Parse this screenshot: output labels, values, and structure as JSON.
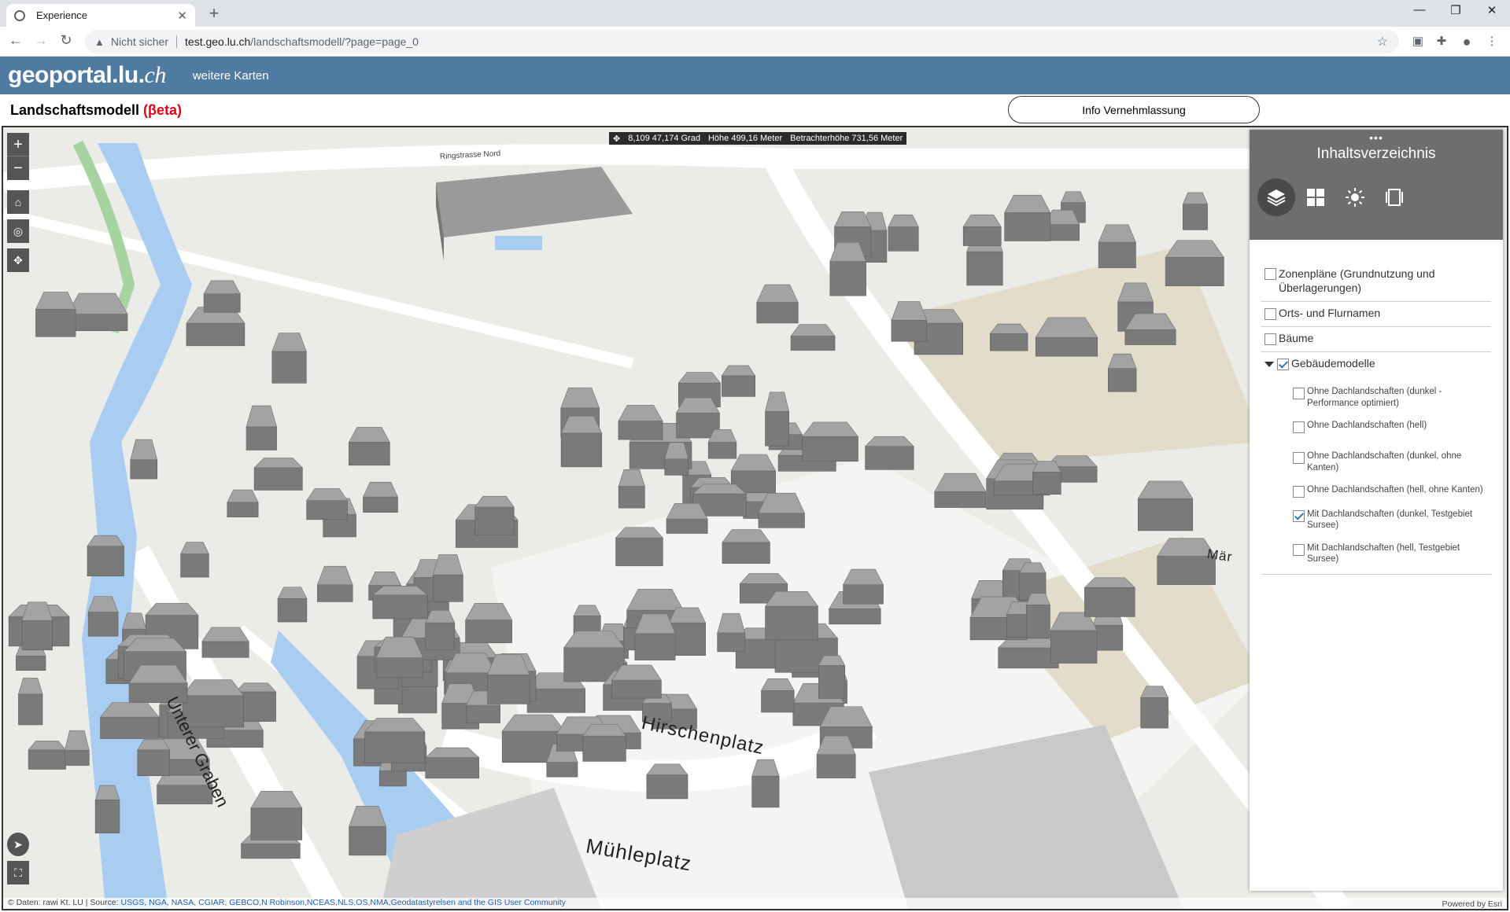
{
  "browser": {
    "tab_title": "Experience",
    "tab_close": "✕",
    "new_tab": "+",
    "security_label": "Nicht sicher",
    "url_host": "test.geo.lu.ch",
    "url_path": "/landschaftsmodell/?page=page_0"
  },
  "header": {
    "logo_text": "geoportal.lu.",
    "logo_suffix": "ch",
    "nav_link": "weitere Karten"
  },
  "page": {
    "title": "Landschaftsmodell",
    "beta": "(βeta)",
    "info_button": "Info Vernehmlassung"
  },
  "map": {
    "coord": "8,109 47,174 Grad",
    "height": "Höhe 499,16 Meter",
    "viewer_height": "Betrachterhöhe 731,56 Meter",
    "street_labels": [
      "Mühleplatz",
      "Hirschenplatz",
      "Unterer Graben",
      "Ringstrasse Nord",
      "Mär"
    ],
    "attribution_prefix": "© Daten: rawi Kt. LU | Source: ",
    "attribution_links": "USGS, NGA, NASA, CGIAR, GEBCO,N Robinson,NCEAS,NLS,OS,NMA,Geodatastyrelsen and the GIS User Community",
    "powered_by": "Powered by Esri"
  },
  "panel": {
    "title": "Inhaltsverzeichnis",
    "tabs": [
      "layers-icon",
      "basemap-gallery-icon",
      "daylight-icon",
      "slides-icon"
    ],
    "layers": [
      {
        "label": "Zonenpläne (Grundnutzung und Überlagerungen)",
        "checked": false
      },
      {
        "label": "Orts- und Flurnamen",
        "checked": false
      },
      {
        "label": "Bäume",
        "checked": false
      },
      {
        "label": "Gebäudemodelle",
        "checked": true,
        "expanded": true
      }
    ],
    "sublayers": [
      {
        "label": "Ohne Dachlandschaften (dunkel - Performance optimiert)",
        "checked": false
      },
      {
        "label": "Ohne Dachlandschaften (hell)",
        "checked": false
      },
      {
        "label": "Ohne Dachlandschaften (dunkel, ohne Kanten)",
        "checked": false
      },
      {
        "label": "Ohne Dachlandschaften (hell, ohne Kanten)",
        "checked": false
      },
      {
        "label": "Mit Dachlandschaften (dunkel, Testgebiet Sursee)",
        "checked": true
      },
      {
        "label": "Mit Dachlandschaften (hell, Testgebiet Sursee)",
        "checked": false
      }
    ]
  },
  "colors": {
    "header_bg": "#4f7ba3",
    "beta_red": "#e0001a",
    "panel_head": "#6e6e6e",
    "water": "#a8cdf0",
    "building": "#8c8c8c"
  }
}
